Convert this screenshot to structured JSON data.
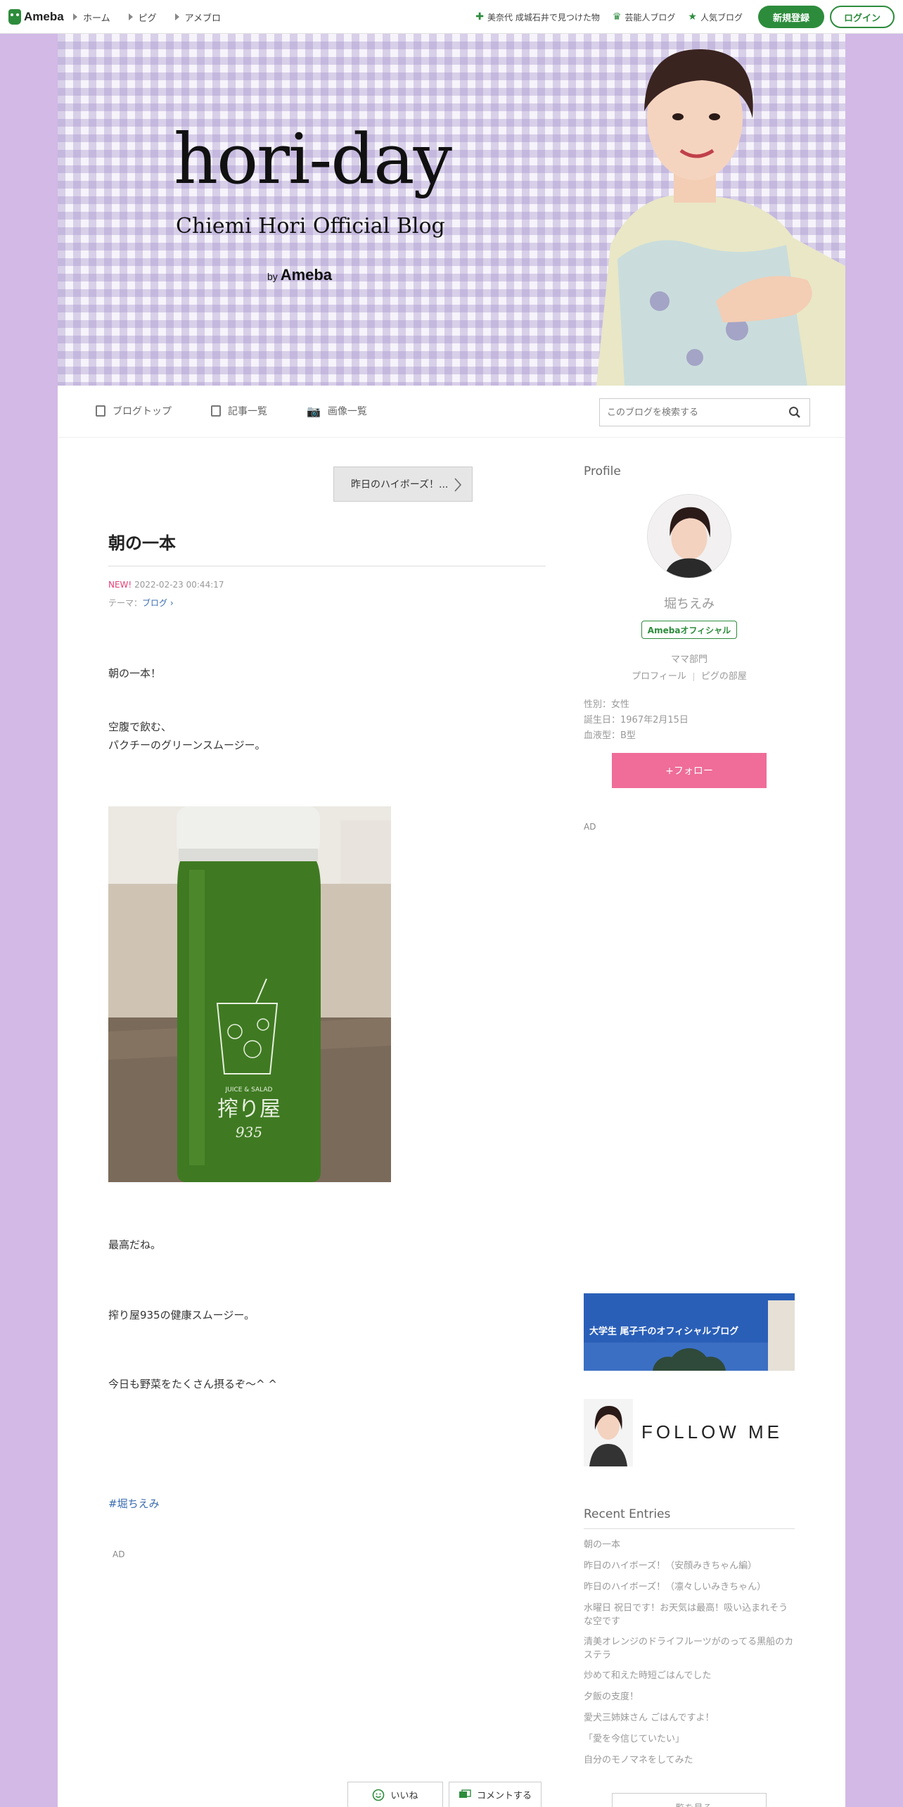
{
  "global_nav": {
    "logo": "Ameba",
    "left": [
      "ホーム",
      "ピグ",
      "アメブロ"
    ],
    "right": [
      {
        "icon": "plus-icon",
        "label": "美奈代 成城石井で見つけた物"
      },
      {
        "icon": "crown-icon",
        "label": "芸能人ブログ"
      },
      {
        "icon": "star-icon",
        "label": "人気ブログ"
      }
    ],
    "signup": "新規登録",
    "login": "ログイン"
  },
  "banner": {
    "title": "hori-day",
    "subtitle": "Chiemi Hori Official Blog",
    "by": "by",
    "brand": "Ameba"
  },
  "blog_nav": {
    "items": [
      "ブログトップ",
      "記事一覧",
      "画像一覧"
    ],
    "search_placeholder": "このブログを検索する"
  },
  "article": {
    "prev_link": "昨日のハイボーズ！...",
    "title": "朝の一本",
    "new_label": "NEW!",
    "date": "2022-02-23 00:44:17",
    "theme_label": "テーマ：",
    "theme": "ブログ",
    "para1": "朝の一本！",
    "para2a": "空腹で飲む、",
    "para2b": "パクチーのグリーンスムージー。",
    "para3": "最高だね。",
    "para4": "搾り屋935の健康スムージー。",
    "para5": "今日も野菜をたくさん摂るぞ〜^ ^",
    "hashtag": "#堀ちえみ",
    "ad": "AD",
    "like": "いいね",
    "comment": "コメントする",
    "bottle_text1": "JUICE & SALAD",
    "bottle_text2": "搾り屋",
    "bottle_text3": "935"
  },
  "sidebar": {
    "profile_heading": "Profile",
    "name": "堀ちえみ",
    "official_badge": "Amebaオフィシャル",
    "category": "ママ部門",
    "links": [
      "プロフィール",
      "ピグの部屋"
    ],
    "gender": "性別：女性",
    "birthday": "誕生日：1967年2月15日",
    "blood": "血液型：B型",
    "follow": "+フォロー",
    "ad": "AD",
    "banner1_text": "大学生 尾子千のオフィシャルブログ",
    "banner2_text": "FOLLOW ME",
    "recent_heading": "Recent Entries",
    "recent": [
      "朝の一本",
      "昨日のハイボーズ！（安顔みきちゃん編）",
      "昨日のハイボーズ！（凛々しいみきちゃん）",
      "水曜日 祝日です！お天気は最高！吸い込まれそうな空です",
      "清美オレンジのドライフルーツがのってる黒船のカステラ",
      "炒めて和えた時短ごはんでした",
      "夕飯の支度！",
      "愛犬三姉妹さん ごはんですよ！",
      "「愛を今信じていたい」",
      "自分のモノマネをしてみた"
    ],
    "more": "一覧を見る"
  },
  "colors": {
    "page_bg": "#d2b9e6",
    "brand_green": "#2d8c3c",
    "follow_pink": "#ef6d98",
    "link_blue": "#3a6cb0"
  }
}
